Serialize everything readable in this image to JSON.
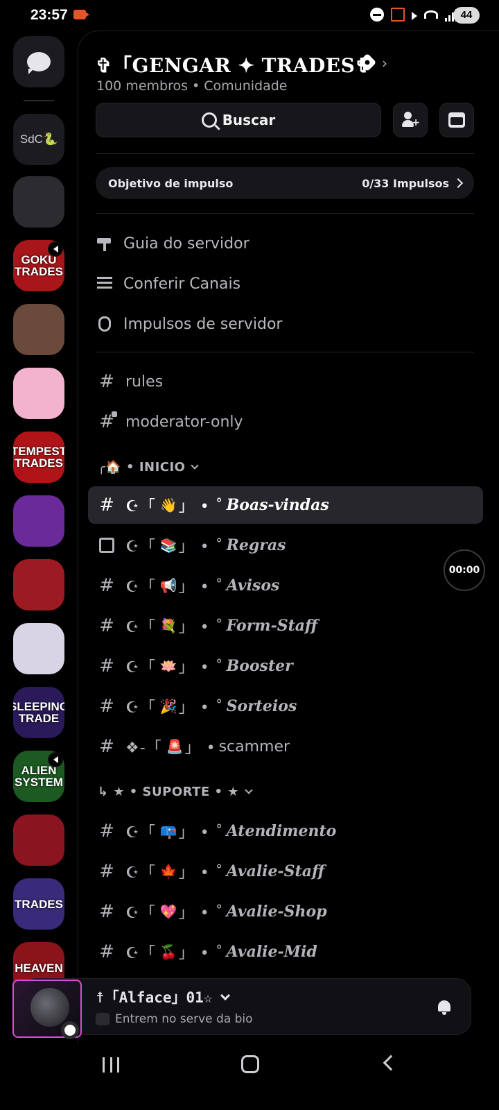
{
  "status_bar": {
    "time": "23:57",
    "battery": "44"
  },
  "rail": {
    "folder_label": "SdC",
    "folder_emoji": "🐍",
    "servers": [
      {
        "label": "",
        "bg": "#2b2b30",
        "volume": false
      },
      {
        "label": "GOKU TRADES",
        "bg": "#a8161a",
        "volume": true
      },
      {
        "label": "",
        "bg": "#6a4a3a",
        "volume": false
      },
      {
        "label": "",
        "bg": "#f3b3cf",
        "volume": false
      },
      {
        "label": "TEMPEST TRADES",
        "bg": "#b01418",
        "volume": false
      },
      {
        "label": "",
        "bg": "#6a2a9a",
        "volume": false
      },
      {
        "label": "",
        "bg": "#9c1a22",
        "volume": false
      },
      {
        "label": "",
        "bg": "#d9d3e6",
        "volume": false
      },
      {
        "label": "SLEEPING TRADE",
        "bg": "#2a1a5a",
        "volume": false
      },
      {
        "label": "ALIEN SYSTEM",
        "bg": "#1c5a22",
        "volume": true
      },
      {
        "label": "",
        "bg": "#8a1420",
        "volume": false
      },
      {
        "label": "TRADES",
        "bg": "#3a2a7a",
        "volume": false
      },
      {
        "label": "HEAVEN",
        "bg": "#8a141a",
        "volume": false
      }
    ]
  },
  "server": {
    "title": "✞「GENGAR ✦ TRADES✞",
    "subtitle": "100 membros • Comunidade"
  },
  "search": {
    "label": "Buscar"
  },
  "boost": {
    "label": "Objetivo de impulso",
    "progress": "0/33 Impulsos"
  },
  "nav": {
    "guide": "Guia do servidor",
    "channels": "Conferir Canais",
    "boosts": "Impulsos de servidor"
  },
  "channels": {
    "rules": "rules",
    "moderator": "moderator-only"
  },
  "categories": {
    "inicio": {
      "prefix": "╭🏠 •",
      "name": "INICIO"
    },
    "suporte": {
      "prefix": "↳  ★ •",
      "name": "SUPORTE • ★"
    }
  },
  "inicio_channels": [
    {
      "prefix": "☪「",
      "emoji": "👋",
      "suffix": "」 • ˚",
      "name": "Boas-vindas",
      "icon": "hash",
      "active": true
    },
    {
      "prefix": "☪「",
      "emoji": "📚",
      "suffix": "」 • ˚",
      "name": "Regras",
      "icon": "rules",
      "active": false
    },
    {
      "prefix": "☪「",
      "emoji": "📢",
      "suffix": "」 • ˚",
      "name": "Avisos",
      "icon": "hash",
      "active": false
    },
    {
      "prefix": "☪「",
      "emoji": "💐",
      "suffix": "」 • ˚",
      "name": "Form-Staff",
      "icon": "hash",
      "active": false
    },
    {
      "prefix": "☪「",
      "emoji": "🪷",
      "suffix": "」 • ˚",
      "name": "Booster",
      "icon": "hash",
      "active": false
    },
    {
      "prefix": "☪「",
      "emoji": "🎉",
      "suffix": "」 • ˚",
      "name": "Sorteios",
      "icon": "hash",
      "active": false
    }
  ],
  "scammer": {
    "prefix": "❖-「",
    "emoji": "🚨",
    "suffix": "」 •",
    "name": "scammer"
  },
  "suporte_channels": [
    {
      "prefix": "☪「",
      "emoji": "📪",
      "suffix": "」 • ˚",
      "name": "Atendimento"
    },
    {
      "prefix": "☪「",
      "emoji": "🍁",
      "suffix": "」 • ˚",
      "name": "Avalie-Staff"
    },
    {
      "prefix": "☪「",
      "emoji": "💖",
      "suffix": "」 • ˚",
      "name": "Avalie-Shop"
    },
    {
      "prefix": "☪「",
      "emoji": "🍒",
      "suffix": "」 • ˚",
      "name": "Avalie-Mid"
    }
  ],
  "timer": "00:00",
  "user": {
    "name": "☨「Alface」01☆",
    "status": "Entrem no serve da bio"
  }
}
